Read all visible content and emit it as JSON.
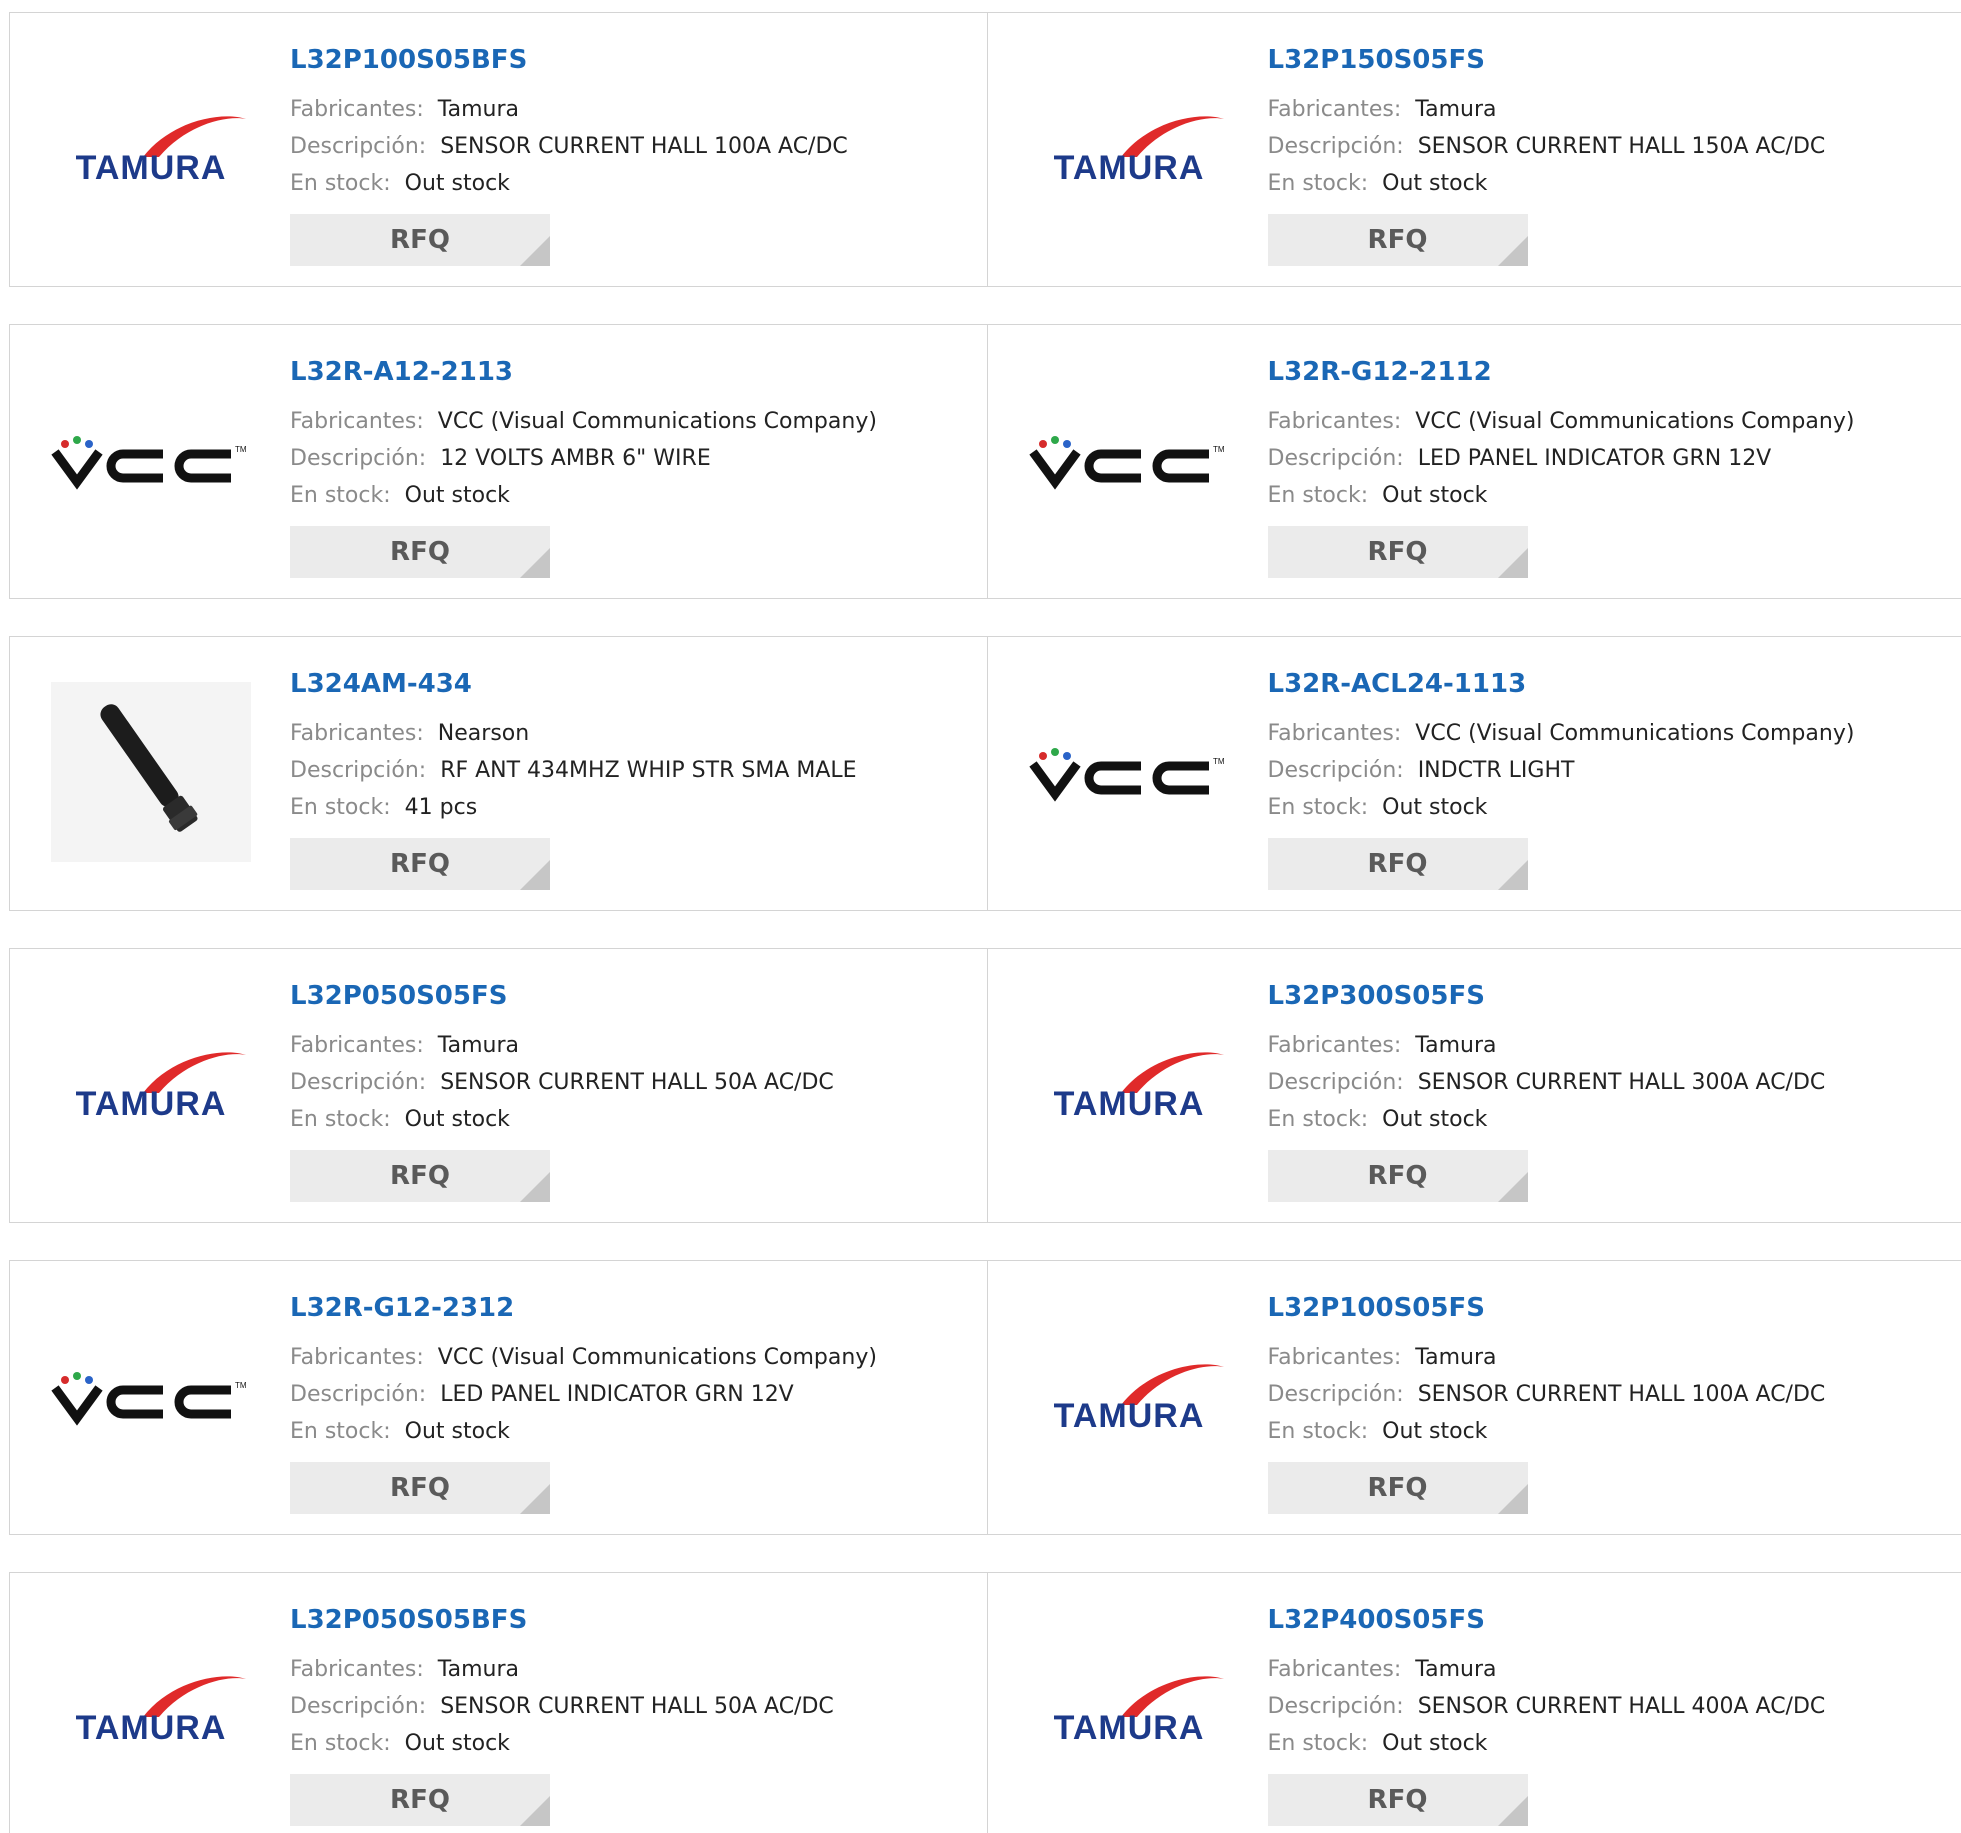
{
  "labels": {
    "manufacturer": "Fabricantes:",
    "description": "Descripción:",
    "stock": "En stock:",
    "rfq": "RFQ"
  },
  "colors": {
    "part_link": "#1a67b5",
    "tamura_red": "#e02a2a",
    "tamura_navy": "#1d3a8a",
    "button_bg": "#ebebeb"
  },
  "products": [
    {
      "part": "L32P100S05BFS",
      "manufacturer": "Tamura",
      "description": "SENSOR CURRENT HALL 100A AC/DC",
      "stock": "Out stock",
      "image": "tamura-logo"
    },
    {
      "part": "L32P150S05FS",
      "manufacturer": "Tamura",
      "description": "SENSOR CURRENT HALL 150A AC/DC",
      "stock": "Out stock",
      "image": "tamura-logo"
    },
    {
      "part": "L32R-A12-2113",
      "manufacturer": "VCC (Visual Communications Company)",
      "description": "12 VOLTS AMBR 6\" WIRE",
      "stock": "Out stock",
      "image": "vcc-logo"
    },
    {
      "part": "L32R-G12-2112",
      "manufacturer": "VCC (Visual Communications Company)",
      "description": "LED PANEL INDICATOR GRN 12V",
      "stock": "Out stock",
      "image": "vcc-logo"
    },
    {
      "part": "L324AM-434",
      "manufacturer": "Nearson",
      "description": "RF ANT 434MHZ WHIP STR SMA MALE",
      "stock": "41 pcs",
      "image": "antenna-photo"
    },
    {
      "part": "L32R-ACL24-1113",
      "manufacturer": "VCC (Visual Communications Company)",
      "description": "INDCTR LIGHT",
      "stock": "Out stock",
      "image": "vcc-logo"
    },
    {
      "part": "L32P050S05FS",
      "manufacturer": "Tamura",
      "description": "SENSOR CURRENT HALL 50A AC/DC",
      "stock": "Out stock",
      "image": "tamura-logo"
    },
    {
      "part": "L32P300S05FS",
      "manufacturer": "Tamura",
      "description": "SENSOR CURRENT HALL 300A AC/DC",
      "stock": "Out stock",
      "image": "tamura-logo"
    },
    {
      "part": "L32R-G12-2312",
      "manufacturer": "VCC (Visual Communications Company)",
      "description": "LED PANEL INDICATOR GRN 12V",
      "stock": "Out stock",
      "image": "vcc-logo"
    },
    {
      "part": "L32P100S05FS",
      "manufacturer": "Tamura",
      "description": "SENSOR CURRENT HALL 100A AC/DC",
      "stock": "Out stock",
      "image": "tamura-logo"
    },
    {
      "part": "L32P050S05BFS",
      "manufacturer": "Tamura",
      "description": "SENSOR CURRENT HALL 50A AC/DC",
      "stock": "Out stock",
      "image": "tamura-logo"
    },
    {
      "part": "L32P400S05FS",
      "manufacturer": "Tamura",
      "description": "SENSOR CURRENT HALL 400A AC/DC",
      "stock": "Out stock",
      "image": "tamura-logo"
    }
  ]
}
